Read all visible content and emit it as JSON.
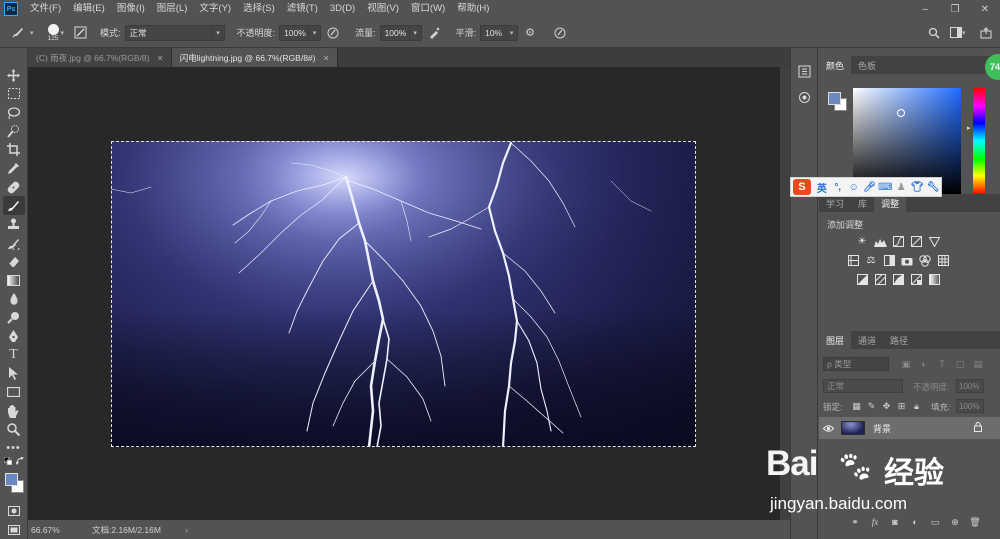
{
  "menubar": {
    "logo": "Ps",
    "items": [
      "文件(F)",
      "编辑(E)",
      "图像(I)",
      "图层(L)",
      "文字(Y)",
      "选择(S)",
      "滤镜(T)",
      "3D(D)",
      "视图(V)",
      "窗口(W)",
      "帮助(H)"
    ],
    "window_controls": [
      "–",
      "❐",
      "✕"
    ]
  },
  "options": {
    "brush_size": "125",
    "mode_label": "模式:",
    "mode_value": "正常",
    "opacity_label": "不透明度:",
    "opacity_value": "100%",
    "flow_label": "流量:",
    "flow_value": "100%",
    "smoothing_label": "平滑:",
    "smoothing_value": "10%"
  },
  "tabs": [
    {
      "label": "(C) 雨夜.jpg @ 66.7%(RGB/8)",
      "close": "×"
    },
    {
      "label": "闪电lightning.jpg @ 66.7%(RGB/8#)",
      "close": "×"
    }
  ],
  "status": {
    "zoom": "66.67%",
    "doc": "文档:2.16M/2.16M",
    "arrow": "›"
  },
  "colors": {
    "foreground": "#6a89c4",
    "background": "#ffffff"
  },
  "color_panel": {
    "tabs": [
      "颜色",
      "色板"
    ]
  },
  "adjust_panel": {
    "tabs": [
      "学习",
      "库",
      "调整"
    ],
    "title": "添加调整"
  },
  "layers_panel": {
    "tabs": [
      "图层",
      "通道",
      "路径"
    ],
    "search_placeholder": "ρ 类型",
    "blend_mode": "正常",
    "opacity_label": "不透明度:",
    "opacity_value": "100%",
    "lock_label": "锁定:",
    "fill_label": "填充:",
    "fill_value": "100%",
    "layers": [
      {
        "name": "背景"
      }
    ]
  },
  "ime": {
    "logo": "S",
    "lang": "英"
  },
  "badge": "74",
  "watermark": {
    "brand": "Bai",
    "brand2": "经验",
    "url": "jingyan.baidu.com"
  }
}
